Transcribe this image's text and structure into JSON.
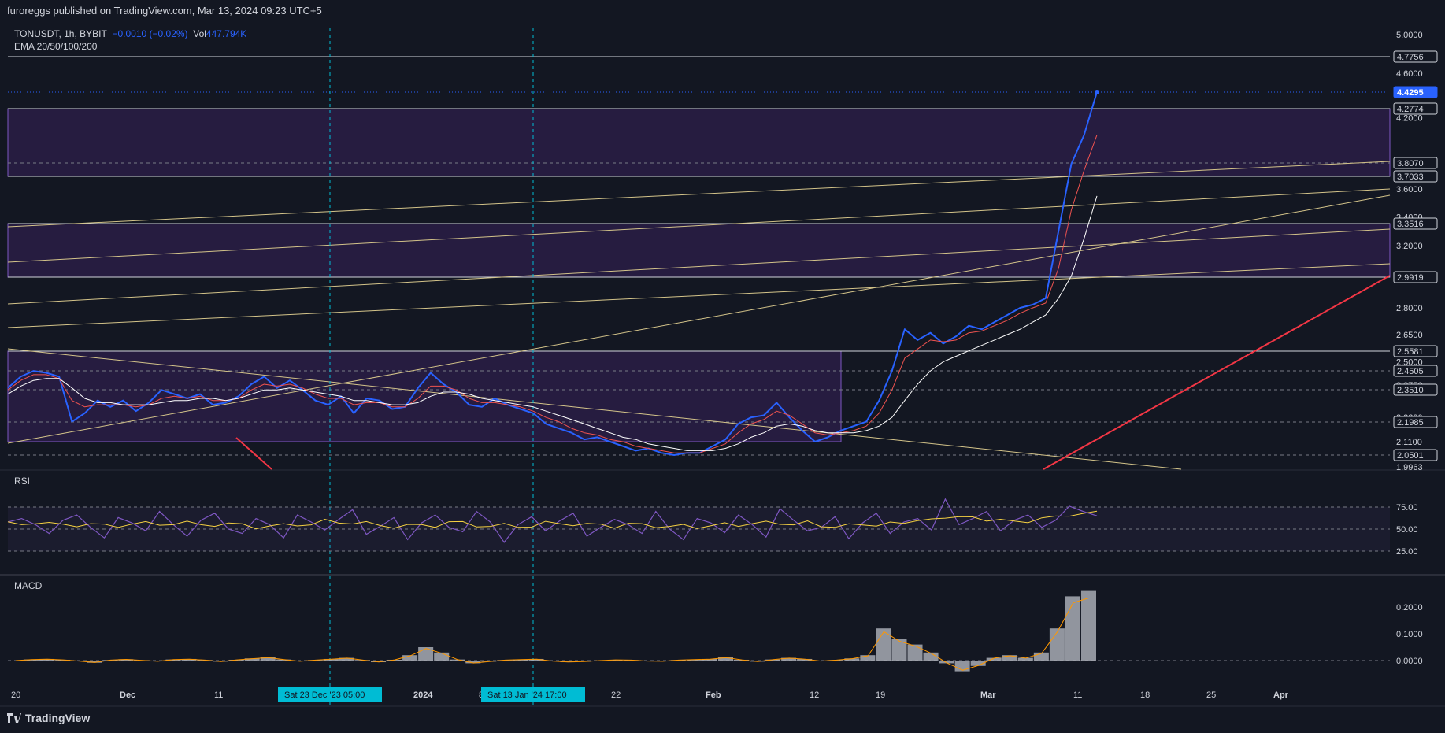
{
  "header": {
    "published": "furoreggs published on TradingView.com, Mar 13, 2024 09:23 UTC+5"
  },
  "legend": {
    "symbol": "TONUSDT, 1h, BYBIT",
    "change": "−0.0010 (−0.02%)",
    "vol_label": "Vol",
    "vol_value": "447.794K",
    "ema": "EMA 20/50/100/200"
  },
  "panes": {
    "rsi": "RSI",
    "macd": "MACD"
  },
  "footer": {
    "brand": "TradingView"
  },
  "colors": {
    "background": "#131722",
    "price": "#2962ff",
    "zone": "#2a1d45",
    "zone_border": "#7e57c2",
    "trend_yellow": "#d4c48a",
    "trend_red": "#f23645",
    "rsi_line": "#7e57c2",
    "rsi_signal": "#f5d142",
    "macd_hist": "#b2b5be",
    "macd_signal": "#ff9800",
    "crosshair": "#00bcd4"
  },
  "chart_data": {
    "type": "line",
    "title": "TONUSDT, 1h, BYBIT",
    "x_axis": {
      "tick_labels": [
        "20",
        "Dec",
        "11",
        "2024",
        "8",
        "22",
        "Feb",
        "12",
        "19",
        "Mar",
        "11",
        "18",
        "25",
        "Apr"
      ],
      "crosshair_labels": [
        "Sat 23 Dec '23   05:00",
        "Sat 13 Jan '24   17:00"
      ]
    },
    "y_axis": {
      "tick_labels": [
        "5.0000",
        "4.6000",
        "4.2000",
        "3.6000",
        "3.4000",
        "3.2000",
        "2.8000",
        "2.6500",
        "2.5000",
        "2.3750",
        "2.2200",
        "2.1100",
        "1.9963"
      ],
      "price_labels": [
        {
          "value": "4.7756",
          "highlight": false
        },
        {
          "value": "4.4295",
          "highlight": true
        },
        {
          "value": "4.2774",
          "highlight": false
        },
        {
          "value": "3.8070",
          "highlight": false
        },
        {
          "value": "3.7033",
          "highlight": false
        },
        {
          "value": "3.3516",
          "highlight": false
        },
        {
          "value": "2.9919",
          "highlight": false
        },
        {
          "value": "2.5581",
          "highlight": false
        },
        {
          "value": "2.4505",
          "highlight": false
        },
        {
          "value": "2.3510",
          "highlight": false
        },
        {
          "value": "2.1985",
          "highlight": false
        },
        {
          "value": "2.0501",
          "highlight": false
        }
      ]
    },
    "zones": [
      {
        "from": 3.7033,
        "to": 4.2774
      },
      {
        "from": 2.9919,
        "to": 3.3516
      },
      {
        "from": 2.11,
        "to": 2.5581
      }
    ],
    "last_price": 4.4295,
    "series": [
      {
        "name": "TONUSDT",
        "values": [
          2.36,
          2.42,
          2.45,
          2.44,
          2.42,
          2.2,
          2.24,
          2.3,
          2.27,
          2.3,
          2.25,
          2.29,
          2.35,
          2.33,
          2.31,
          2.33,
          2.28,
          2.29,
          2.32,
          2.38,
          2.42,
          2.36,
          2.4,
          2.35,
          2.3,
          2.28,
          2.32,
          2.24,
          2.31,
          2.3,
          2.26,
          2.27,
          2.36,
          2.44,
          2.38,
          2.34,
          2.28,
          2.27,
          2.31,
          2.28,
          2.26,
          2.24,
          2.19,
          2.17,
          2.15,
          2.12,
          2.13,
          2.11,
          2.09,
          2.07,
          2.08,
          2.06,
          2.05,
          2.06,
          2.06,
          2.09,
          2.12,
          2.19,
          2.22,
          2.23,
          2.29,
          2.22,
          2.16,
          2.11,
          2.13,
          2.16,
          2.18,
          2.2,
          2.3,
          2.45,
          2.68,
          2.62,
          2.66,
          2.6,
          2.64,
          2.7,
          2.68,
          2.72,
          2.76,
          2.8,
          2.82,
          2.86,
          3.3,
          3.8,
          4.05,
          4.43
        ]
      },
      {
        "name": "EMA 20",
        "values": [
          2.35,
          2.4,
          2.43,
          2.43,
          2.41,
          2.3,
          2.27,
          2.28,
          2.28,
          2.28,
          2.27,
          2.28,
          2.31,
          2.32,
          2.31,
          2.32,
          2.3,
          2.3,
          2.31,
          2.35,
          2.38,
          2.37,
          2.38,
          2.36,
          2.33,
          2.31,
          2.31,
          2.28,
          2.29,
          2.29,
          2.27,
          2.27,
          2.31,
          2.37,
          2.37,
          2.35,
          2.31,
          2.29,
          2.29,
          2.28,
          2.27,
          2.25,
          2.22,
          2.2,
          2.17,
          2.15,
          2.14,
          2.12,
          2.11,
          2.09,
          2.08,
          2.07,
          2.06,
          2.06,
          2.06,
          2.08,
          2.1,
          2.15,
          2.19,
          2.21,
          2.25,
          2.23,
          2.19,
          2.15,
          2.14,
          2.15,
          2.16,
          2.18,
          2.24,
          2.35,
          2.52,
          2.57,
          2.62,
          2.61,
          2.62,
          2.66,
          2.67,
          2.7,
          2.73,
          2.77,
          2.8,
          2.83,
          3.05,
          3.45,
          3.75,
          4.05
        ]
      },
      {
        "name": "EMA 200",
        "values": [
          2.33,
          2.37,
          2.4,
          2.41,
          2.41,
          2.36,
          2.31,
          2.29,
          2.29,
          2.28,
          2.28,
          2.28,
          2.29,
          2.3,
          2.3,
          2.31,
          2.31,
          2.3,
          2.31,
          2.33,
          2.35,
          2.35,
          2.36,
          2.35,
          2.34,
          2.33,
          2.32,
          2.3,
          2.3,
          2.29,
          2.28,
          2.28,
          2.29,
          2.32,
          2.34,
          2.34,
          2.33,
          2.31,
          2.3,
          2.29,
          2.28,
          2.27,
          2.25,
          2.23,
          2.21,
          2.19,
          2.17,
          2.15,
          2.13,
          2.12,
          2.1,
          2.09,
          2.08,
          2.07,
          2.07,
          2.07,
          2.08,
          2.1,
          2.13,
          2.15,
          2.18,
          2.19,
          2.18,
          2.16,
          2.15,
          2.15,
          2.15,
          2.16,
          2.18,
          2.22,
          2.3,
          2.38,
          2.45,
          2.5,
          2.53,
          2.56,
          2.59,
          2.62,
          2.65,
          2.68,
          2.72,
          2.76,
          2.86,
          3.0,
          3.25,
          3.55
        ]
      }
    ],
    "rsi": {
      "levels": [
        "75.00",
        "50.00",
        "25.00"
      ],
      "values": [
        58,
        62,
        55,
        45,
        60,
        66,
        52,
        40,
        63,
        57,
        48,
        70,
        55,
        42,
        60,
        68,
        50,
        45,
        62,
        55,
        40,
        66,
        58,
        49,
        61,
        72,
        44,
        53,
        63,
        38,
        57,
        66,
        52,
        47,
        70,
        58,
        35,
        55,
        64,
        48,
        59,
        68,
        42,
        52,
        61,
        55,
        45,
        70,
        50,
        38,
        62,
        57,
        46,
        66,
        55,
        41,
        73,
        60,
        48,
        52,
        64,
        39,
        57,
        68,
        45,
        58,
        62,
        49,
        84,
        55,
        62,
        70,
        48,
        60,
        66,
        52,
        60,
        76,
        70,
        65
      ]
    },
    "macd": {
      "levels": [
        "0.2000",
        "0.1000",
        "0.0000"
      ],
      "hist": [
        0.0,
        0.004,
        0.006,
        0.003,
        -0.002,
        -0.008,
        0.002,
        0.005,
        0.001,
        -0.003,
        0.004,
        0.006,
        0.002,
        -0.004,
        0.003,
        0.008,
        0.012,
        0.004,
        -0.003,
        0.002,
        0.006,
        0.01,
        0.002,
        -0.006,
        0.003,
        0.02,
        0.05,
        0.03,
        0.004,
        -0.01,
        -0.004,
        0.002,
        0.004,
        0.006,
        -0.002,
        -0.006,
        -0.004,
        0.0,
        0.003,
        0.002,
        -0.002,
        -0.003,
        0.002,
        0.004,
        0.006,
        0.012,
        0.003,
        -0.004,
        0.004,
        0.01,
        0.006,
        -0.002,
        0.002,
        0.008,
        0.02,
        0.12,
        0.08,
        0.06,
        0.03,
        -0.01,
        -0.04,
        -0.02,
        0.01,
        0.02,
        0.01,
        0.03,
        0.12,
        0.24,
        0.26
      ]
    }
  }
}
